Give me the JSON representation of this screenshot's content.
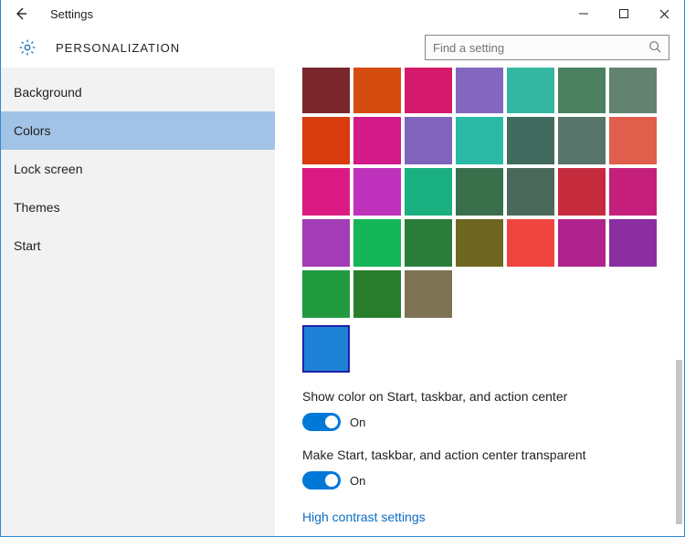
{
  "window": {
    "title": "Settings"
  },
  "header": {
    "section": "PERSONALIZATION",
    "search_placeholder": "Find a setting"
  },
  "sidebar": {
    "items": [
      {
        "label": "Background",
        "selected": false
      },
      {
        "label": "Colors",
        "selected": true
      },
      {
        "label": "Lock screen",
        "selected": false
      },
      {
        "label": "Themes",
        "selected": false
      },
      {
        "label": "Start",
        "selected": false
      }
    ]
  },
  "palette": {
    "colors": [
      "#7a282c",
      "#d54c11",
      "#d61a6b",
      "#8366c0",
      "#35b8a2",
      "#4b8060",
      "#63826f",
      "#d73b0e",
      "#d21a88",
      "#8064bb",
      "#2bbaa6",
      "#406b5e",
      "#57756a",
      "#df5e4c",
      "#db1b83",
      "#bf32bb",
      "#1bb07f",
      "#3a6f4c",
      "#4b695a",
      "#c42c3e",
      "#c41f7a",
      "#a23db5",
      "#14b657",
      "#2c7d3a",
      "#6d6721",
      "#f0443f",
      "#af248c",
      "#8b2ea1",
      "#229a40",
      "#287d2d",
      "#7d7354"
    ],
    "selected_color": "#1e82d6"
  },
  "settings": {
    "show_color": {
      "label": "Show color on Start, taskbar, and action center",
      "state": "On"
    },
    "transparency": {
      "label": "Make Start, taskbar, and action center transparent",
      "state": "On"
    },
    "link": "High contrast settings"
  }
}
